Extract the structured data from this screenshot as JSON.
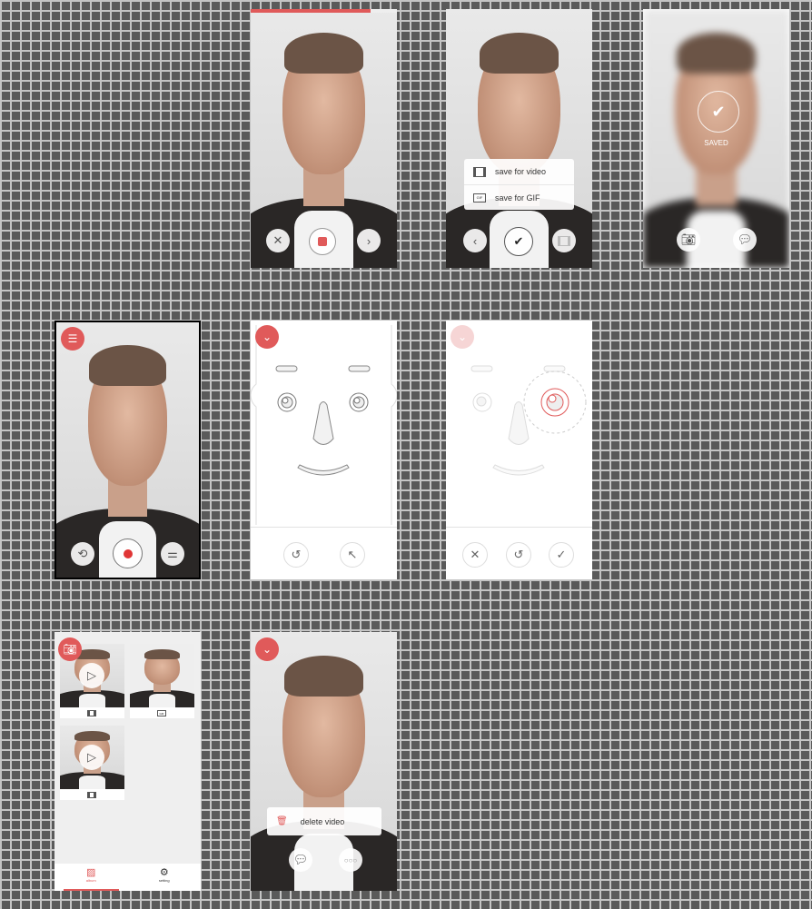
{
  "recording": {
    "progress": 0.82,
    "colors": {
      "accent": "#e05a5a"
    }
  },
  "save_menu": {
    "items": [
      {
        "icon": "film-icon",
        "label": "save for video"
      },
      {
        "icon": "gif-icon",
        "label": "save for GIF"
      }
    ]
  },
  "saved": {
    "label": "SAVED"
  },
  "album": {
    "tabs": [
      {
        "label": "album",
        "active": true
      },
      {
        "label": "setting",
        "active": false
      }
    ],
    "items": [
      {
        "type": "video"
      },
      {
        "type": "gif"
      },
      {
        "type": "video"
      }
    ]
  },
  "delete": {
    "menu_label": "delete video"
  }
}
